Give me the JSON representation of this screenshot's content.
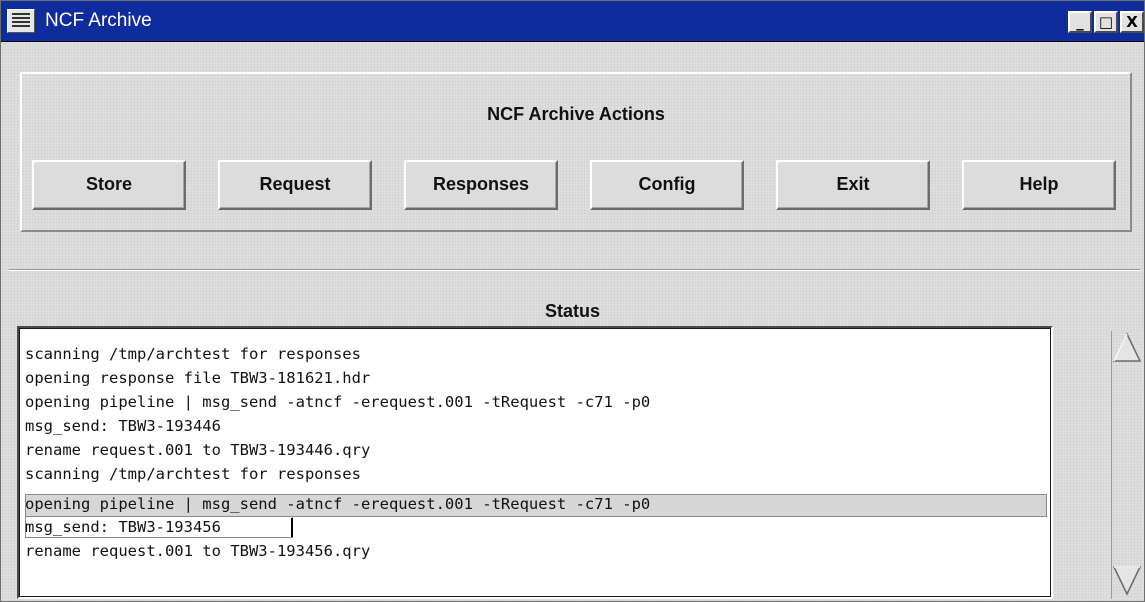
{
  "window": {
    "title": "NCF Archive",
    "icons": {
      "system_menu": "menu-lines-icon",
      "minimize": "minimize-icon",
      "maximize": "maximize-icon",
      "close": "close-icon"
    },
    "controls": {
      "minimize": "_",
      "maximize": "□",
      "close": "X"
    }
  },
  "actions": {
    "title": "NCF Archive Actions",
    "buttons": [
      "Store",
      "Request",
      "Responses",
      "Config",
      "Exit",
      "Help"
    ]
  },
  "status": {
    "title": "Status",
    "lines": [
      "scanning /tmp/archtest for responses",
      "opening response file TBW3-181621.hdr",
      "opening pipeline | msg_send -atncf -erequest.001 -tRequest -c71 -p0",
      "msg_send: TBW3-193446",
      "rename request.001 to TBW3-193446.qry",
      "scanning /tmp/archtest for responses",
      "opening pipeline | msg_send -atncf -erequest.001 -tRequest -c71 -p0",
      "msg_send: TBW3-193456",
      "rename request.001 to TBW3-193456.qry"
    ],
    "selected_line_index": 6
  },
  "scrollbar": {
    "up_icon": "scroll-up-arrow-icon",
    "down_icon": "scroll-down-arrow-icon"
  },
  "colors": {
    "titlebar": "#0f2c9c",
    "panel": "#dedede",
    "log_background": "#ffffff"
  }
}
